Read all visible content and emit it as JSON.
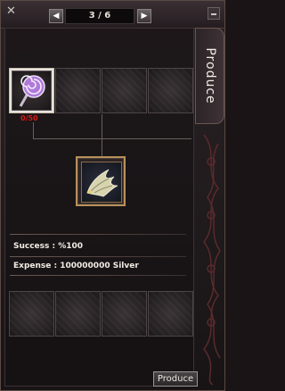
{
  "window": {
    "close_label": "✕",
    "page_indicator": "3 / 6",
    "prev_label": "◀",
    "next_label": "▶",
    "side_tab_label": "Produce"
  },
  "materials": [
    {
      "icon": "lollipop-icon",
      "quantity": "0/50"
    },
    {
      "icon": "empty-slot"
    },
    {
      "icon": "empty-slot"
    },
    {
      "icon": "empty-slot"
    }
  ],
  "result": {
    "icon": "dragon-wing-icon"
  },
  "info": {
    "success_text": "Success : %100",
    "expense_text": "Expense : 100000000 Silver"
  },
  "extra_slots": 4,
  "buttons": {
    "produce_label": "Produce"
  },
  "colors": {
    "quantity_red": "#d31c18",
    "frame_gold": "#b8905a"
  }
}
